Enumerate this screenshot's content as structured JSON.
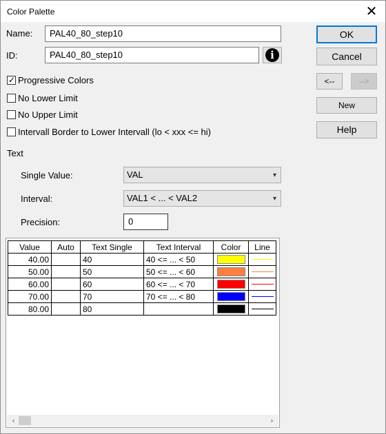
{
  "window": {
    "title": "Color Palette"
  },
  "fields": {
    "name_label": "Name:",
    "name_value": "PAL40_80_step10",
    "id_label": "ID:",
    "id_value": "PAL40_80_step10",
    "info_glyph": "i"
  },
  "buttons": {
    "ok": "OK",
    "cancel": "Cancel",
    "prev": "<--",
    "next": "-->",
    "new": "New",
    "help": "Help"
  },
  "options": [
    {
      "label": "Progressive Colors",
      "checked": true
    },
    {
      "label": "No Lower Limit",
      "checked": false
    },
    {
      "label": "No Upper Limit",
      "checked": false
    },
    {
      "label": "Intervall Border to Lower Intervall (lo < xxx <= hi)",
      "checked": false
    }
  ],
  "text_section": {
    "heading": "Text",
    "single_value_label": "Single Value:",
    "single_value_selected": "VAL",
    "interval_label": "Interval:",
    "interval_selected": "VAL1 < ... < VAL2",
    "precision_label": "Precision:",
    "precision_value": "0"
  },
  "table": {
    "columns": [
      "Value",
      "Auto",
      "Text Single",
      "Text Interval",
      "Color",
      "Line"
    ],
    "rows": [
      {
        "value": "40.00",
        "auto": "",
        "text_single": "40",
        "text_interval": "40 <= ... < 50",
        "color": "#ffff00"
      },
      {
        "value": "50.00",
        "auto": "",
        "text_single": "50",
        "text_interval": "50 <= ... < 60",
        "color": "#ff7f3f"
      },
      {
        "value": "60.00",
        "auto": "",
        "text_single": "60",
        "text_interval": "60 <= ... < 70",
        "color": "#ff0000"
      },
      {
        "value": "70.00",
        "auto": "",
        "text_single": "70",
        "text_interval": "70 <= ... < 80",
        "color": "#0000ff"
      },
      {
        "value": "80.00",
        "auto": "",
        "text_single": "80",
        "text_interval": "",
        "color": "#000000"
      }
    ]
  }
}
